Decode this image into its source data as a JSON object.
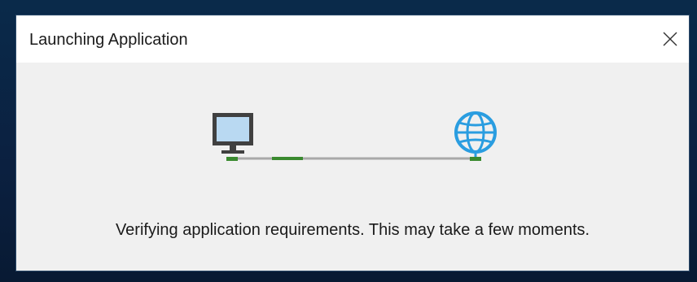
{
  "window": {
    "title": "Launching Application",
    "close_icon": "close-icon"
  },
  "status": {
    "message": "Verifying application requirements. This may take a few moments."
  },
  "diagram": {
    "left_icon": "computer-icon",
    "right_icon": "globe-icon",
    "colors": {
      "connection_line": "#a9a9a9",
      "activity": "#3a8a2f",
      "monitor_frame": "#404040",
      "monitor_screen": "#b9d9f2",
      "globe": "#2a9de0"
    }
  }
}
